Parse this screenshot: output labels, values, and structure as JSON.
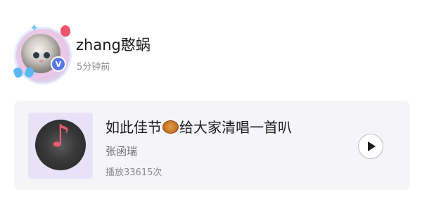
{
  "post": {
    "username": "zhang憨蜗",
    "time_ago": "5分钟前",
    "verified_badge": "V"
  },
  "music_card": {
    "title_part1": "如此佳节",
    "title_part2": "给大家清唱一首叭",
    "artist": "张函瑞",
    "play_count_label": "播放33615次",
    "cover_icon": "music-note-icon",
    "accent_color": "#f25b73"
  }
}
